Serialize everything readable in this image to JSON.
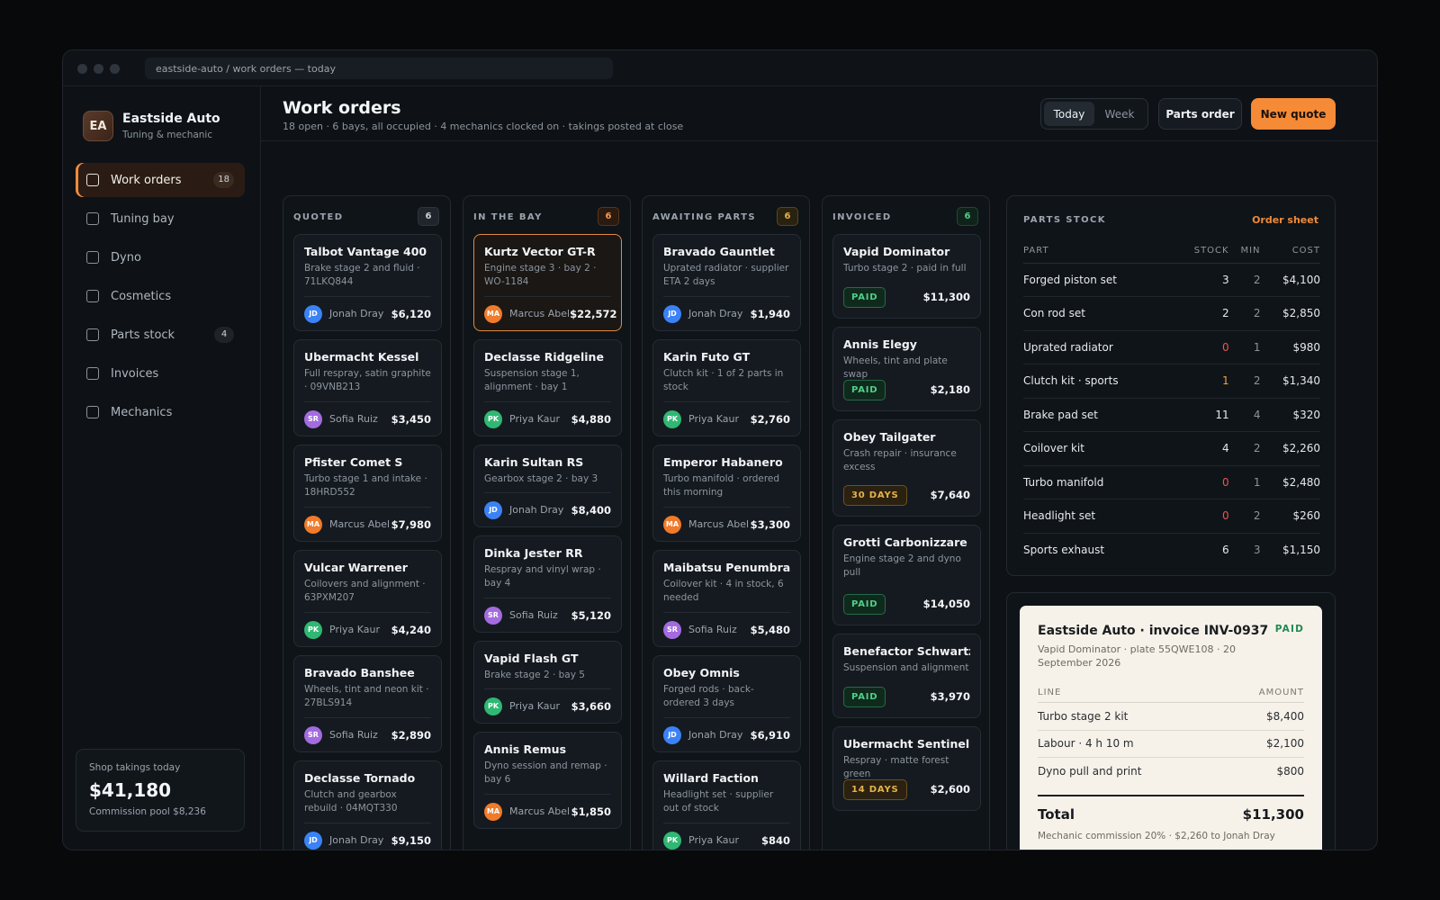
{
  "window": {
    "address": "eastside-auto / work orders — today"
  },
  "brand": {
    "initials": "EA",
    "name": "Eastside Auto",
    "subtitle": "Tuning & mechanic"
  },
  "nav": [
    {
      "label": "Work orders",
      "badge": "18",
      "active": true
    },
    {
      "label": "Tuning bay",
      "badge": ""
    },
    {
      "label": "Dyno",
      "badge": ""
    },
    {
      "label": "Cosmetics",
      "badge": ""
    },
    {
      "label": "Parts stock",
      "badge": "4"
    },
    {
      "label": "Invoices",
      "badge": ""
    },
    {
      "label": "Mechanics",
      "badge": ""
    }
  ],
  "takings": {
    "label": "Shop takings today",
    "value": "$41,180",
    "sub": "Commission pool $8,236"
  },
  "header": {
    "title": "Work orders",
    "subtitle": "18 open · 6 bays, all occupied · 4 mechanics clocked on · takings posted at close",
    "seg_today": "Today",
    "seg_week": "Week",
    "parts_button": "Parts order",
    "quote_button": "New quote"
  },
  "mechanic_colors": {
    "JD": "#3b82f6",
    "SR": "#a36be0",
    "MA": "#f07b2a",
    "PK": "#2fb873"
  },
  "columns": [
    {
      "title": "QUOTED",
      "count": "6",
      "count_style": "grey",
      "cards": [
        {
          "title": "Talbot Vantage 400",
          "desc": "Brake stage 2 and fluid · 71LKQ844",
          "initials": "JD",
          "mechanic": "Jonah Dray",
          "amount": "$6,120"
        },
        {
          "title": "Ubermacht Kessel",
          "desc": "Full respray, satin graphite · 09VNB213",
          "initials": "SR",
          "mechanic": "Sofia Ruiz",
          "amount": "$3,450"
        },
        {
          "title": "Pfister Comet S",
          "desc": "Turbo stage 1 and intake · 18HRD552",
          "initials": "MA",
          "mechanic": "Marcus Abel",
          "amount": "$7,980"
        },
        {
          "title": "Vulcar Warrener",
          "desc": "Coilovers and alignment · 63PXM207",
          "initials": "PK",
          "mechanic": "Priya Kaur",
          "amount": "$4,240"
        },
        {
          "title": "Bravado Banshee",
          "desc": "Wheels, tint and neon kit · 27BLS914",
          "initials": "SR",
          "mechanic": "Sofia Ruiz",
          "amount": "$2,890"
        },
        {
          "title": "Declasse Tornado",
          "desc": "Clutch and gearbox rebuild · 04MQT330",
          "initials": "JD",
          "mechanic": "Jonah Dray",
          "amount": "$9,150"
        }
      ]
    },
    {
      "title": "IN THE BAY",
      "count": "6",
      "count_style": "orange",
      "cards": [
        {
          "title": "Kurtz Vector GT-R",
          "desc": "Engine stage 3 · bay 2 · WO-1184",
          "initials": "MA",
          "mechanic": "Marcus Abel",
          "amount": "$22,572",
          "highlight": true
        },
        {
          "title": "Declasse Ridgeline",
          "desc": "Suspension stage 1, alignment · bay 1",
          "initials": "PK",
          "mechanic": "Priya Kaur",
          "amount": "$4,880"
        },
        {
          "title": "Karin Sultan RS",
          "desc": "Gearbox stage 2 · bay 3",
          "initials": "JD",
          "mechanic": "Jonah Dray",
          "amount": "$8,400"
        },
        {
          "title": "Dinka Jester RR",
          "desc": "Respray and vinyl wrap · bay 4",
          "initials": "SR",
          "mechanic": "Sofia Ruiz",
          "amount": "$5,120"
        },
        {
          "title": "Vapid Flash GT",
          "desc": "Brake stage 2 · bay 5",
          "initials": "PK",
          "mechanic": "Priya Kaur",
          "amount": "$3,660"
        },
        {
          "title": "Annis Remus",
          "desc": "Dyno session and remap · bay 6",
          "initials": "MA",
          "mechanic": "Marcus Abel",
          "amount": "$1,850"
        }
      ]
    },
    {
      "title": "AWAITING PARTS",
      "count": "6",
      "count_style": "amber",
      "cards": [
        {
          "title": "Bravado Gauntlet",
          "desc": "Uprated radiator · supplier ETA 2 days",
          "initials": "JD",
          "mechanic": "Jonah Dray",
          "amount": "$1,940"
        },
        {
          "title": "Karin Futo GT",
          "desc": "Clutch kit · 1 of 2 parts in stock",
          "initials": "PK",
          "mechanic": "Priya Kaur",
          "amount": "$2,760"
        },
        {
          "title": "Emperor Habanero",
          "desc": "Turbo manifold · ordered this morning",
          "initials": "MA",
          "mechanic": "Marcus Abel",
          "amount": "$3,300"
        },
        {
          "title": "Maibatsu Penumbra",
          "desc": "Coilover kit · 4 in stock, 6 needed",
          "initials": "SR",
          "mechanic": "Sofia Ruiz",
          "amount": "$5,480"
        },
        {
          "title": "Obey Omnis",
          "desc": "Forged rods · back-ordered 3 days",
          "initials": "JD",
          "mechanic": "Jonah Dray",
          "amount": "$6,910"
        },
        {
          "title": "Willard Faction",
          "desc": "Headlight set · supplier out of stock",
          "initials": "PK",
          "mechanic": "Priya Kaur",
          "amount": "$840"
        }
      ]
    },
    {
      "title": "INVOICED",
      "count": "6",
      "count_style": "green",
      "cards": [
        {
          "title": "Vapid Dominator",
          "desc": "Turbo stage 2 · paid in full",
          "status": "PAID",
          "amount": "$11,300"
        },
        {
          "title": "Annis Elegy",
          "desc": "Wheels, tint and plate swap",
          "status": "PAID",
          "amount": "$2,180"
        },
        {
          "title": "Obey Tailgater",
          "desc": "Crash repair · insurance excess",
          "status": "30 DAYS",
          "amount": "$7,640"
        },
        {
          "title": "Grotti Carbonizzare",
          "desc": "Engine stage 2 and dyno pull",
          "status": "PAID",
          "amount": "$14,050"
        },
        {
          "title": "Benefactor Schwartzer",
          "desc": "Suspension and alignment",
          "status": "PAID",
          "amount": "$3,970"
        },
        {
          "title": "Ubermacht Sentinel",
          "desc": "Respray · matte forest green",
          "status": "14 DAYS",
          "amount": "$2,600"
        }
      ]
    }
  ],
  "stock": {
    "title": "PARTS STOCK",
    "link": "Order sheet",
    "headers": [
      "PART",
      "STOCK",
      "MIN",
      "COST"
    ],
    "rows": [
      {
        "part": "Forged piston set",
        "stock": "3",
        "min": "2",
        "cost": "$4,100",
        "level": "ok"
      },
      {
        "part": "Con rod set",
        "stock": "2",
        "min": "2",
        "cost": "$2,850",
        "level": "ok"
      },
      {
        "part": "Uprated radiator",
        "stock": "0",
        "min": "1",
        "cost": "$980",
        "level": "zero"
      },
      {
        "part": "Clutch kit · sports",
        "stock": "1",
        "min": "2",
        "cost": "$1,340",
        "level": "low"
      },
      {
        "part": "Brake pad set",
        "stock": "11",
        "min": "4",
        "cost": "$320",
        "level": "ok"
      },
      {
        "part": "Coilover kit",
        "stock": "4",
        "min": "2",
        "cost": "$2,260",
        "level": "ok"
      },
      {
        "part": "Turbo manifold",
        "stock": "0",
        "min": "1",
        "cost": "$2,480",
        "level": "zero"
      },
      {
        "part": "Headlight set",
        "stock": "0",
        "min": "2",
        "cost": "$260",
        "level": "zero"
      },
      {
        "part": "Sports exhaust",
        "stock": "6",
        "min": "3",
        "cost": "$1,150",
        "level": "ok"
      }
    ]
  },
  "invoice": {
    "title": "Eastside Auto · invoice INV-0937",
    "status": "PAID",
    "sub": "Vapid Dominator · plate 55QWE108 · 20 September 2026",
    "col_line": "LINE",
    "col_amount": "AMOUNT",
    "lines": [
      {
        "label": "Turbo stage 2 kit",
        "amount": "$8,400"
      },
      {
        "label": "Labour · 4 h 10 m",
        "amount": "$2,100"
      },
      {
        "label": "Dyno pull and print",
        "amount": "$800"
      }
    ],
    "total_label": "Total",
    "total": "$11,300",
    "note": "Mechanic commission 20% · $2,260 to Jonah Dray"
  }
}
